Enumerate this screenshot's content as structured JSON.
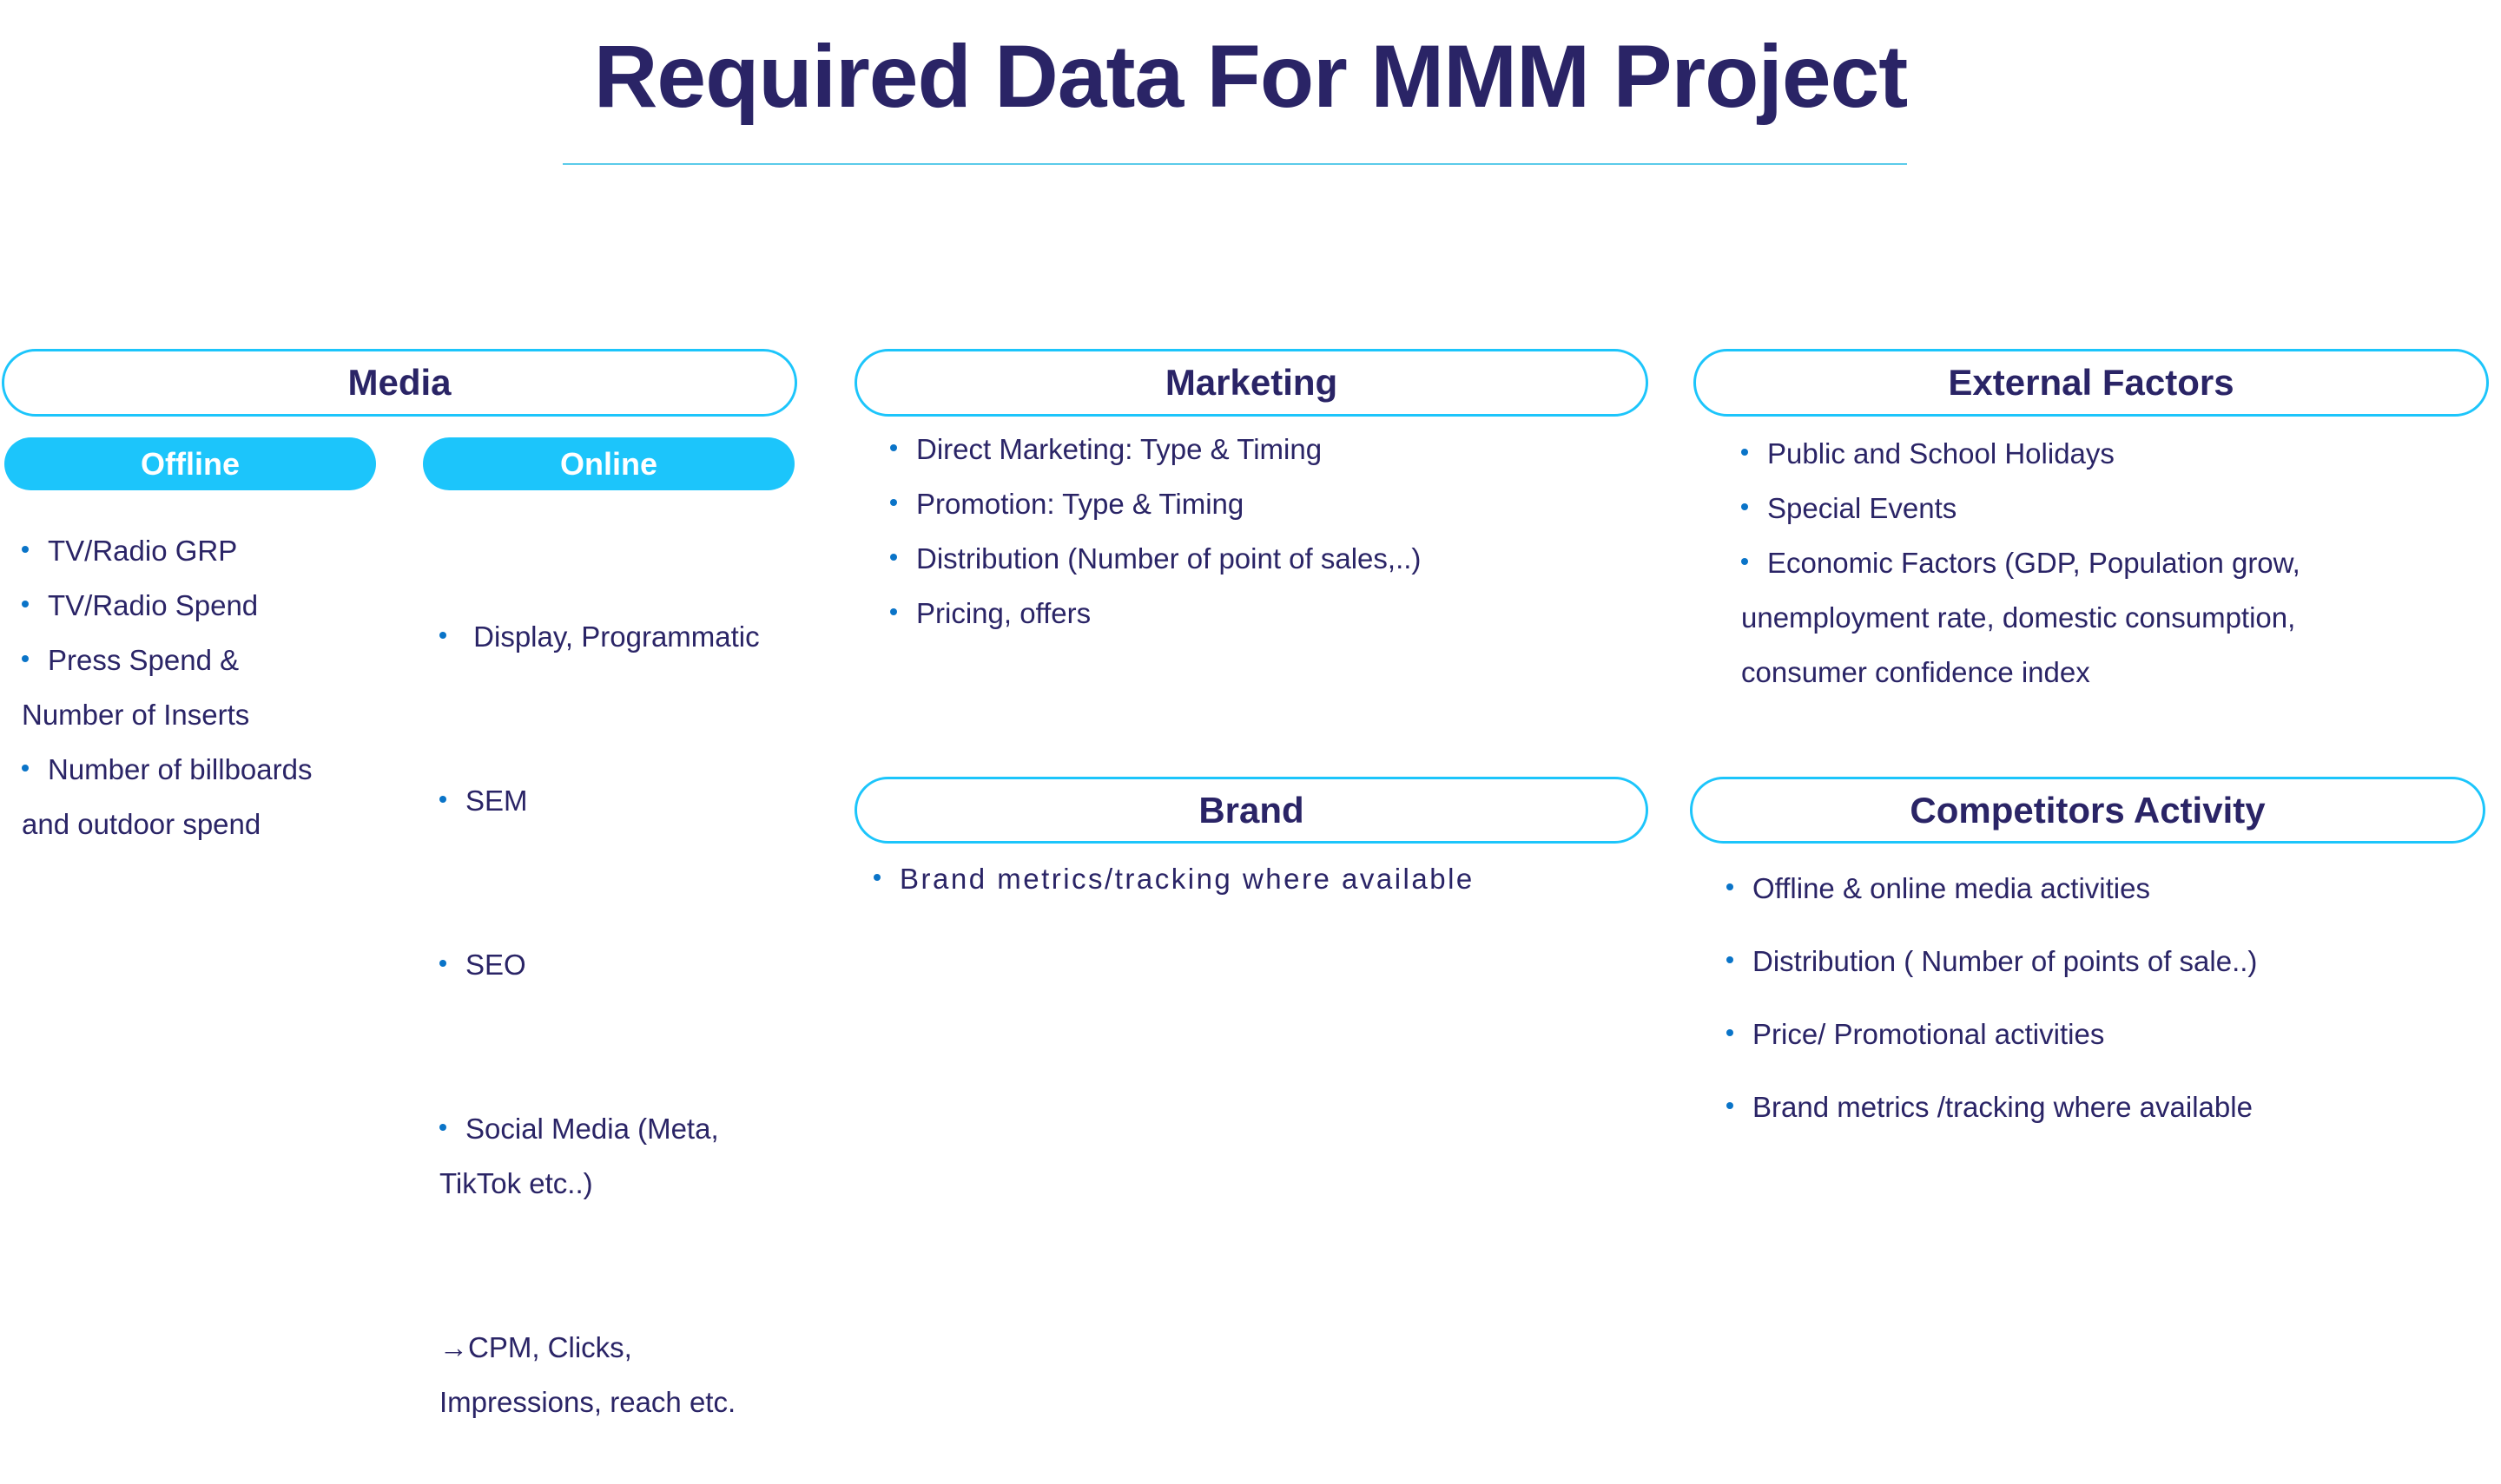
{
  "title": "Required Data For MMM Project",
  "colors": {
    "title_text": "#2a2466",
    "accent": "#1cc5fb",
    "rule": "#5bcbea",
    "bullet": "#0a74c8"
  },
  "media": {
    "header": "Media",
    "offline": {
      "label": "Offline",
      "items": [
        {
          "text": "TV/Radio GRP",
          "cont": ""
        },
        {
          "text": "TV/Radio Spend",
          "cont": ""
        },
        {
          "text": "Press Spend &",
          "cont": "Number of Inserts"
        },
        {
          "text": "Number of billboards",
          "cont": "and outdoor spend"
        }
      ]
    },
    "online": {
      "label": "Online",
      "items": [
        {
          "text": " Display, Programmatic",
          "cont": ""
        },
        {
          "text": "SEM",
          "cont": ""
        },
        {
          "text": "SEO",
          "cont": ""
        },
        {
          "text": "Social Media (Meta,",
          "cont": "TikTok etc..)"
        }
      ],
      "arrow_icon": "→",
      "arrow_line1": "CPM, Clicks,",
      "arrow_line2": "Impressions, reach etc."
    }
  },
  "marketing": {
    "header": "Marketing",
    "items": [
      "Direct Marketing: Type & Timing",
      "Promotion: Type & Timing",
      "Distribution (Number of point of sales,..)",
      "Pricing, offers"
    ]
  },
  "external": {
    "header": "External Factors",
    "items": [
      {
        "text": "Public and School Holidays",
        "cont": []
      },
      {
        "text": "Special Events",
        "cont": []
      },
      {
        "text": "Economic Factors (GDP, Population grow,",
        "cont": [
          "unemployment rate, domestic consumption,",
          "consumer confidence index"
        ]
      }
    ]
  },
  "brand": {
    "header": "Brand",
    "items": [
      "Brand metrics/tracking where available"
    ]
  },
  "competitors": {
    "header": "Competitors Activity",
    "items": [
      "Offline & online media activities",
      "Distribution ( Number of points of sale..)",
      "Price/ Promotional activities",
      "Brand metrics /tracking where available"
    ]
  }
}
